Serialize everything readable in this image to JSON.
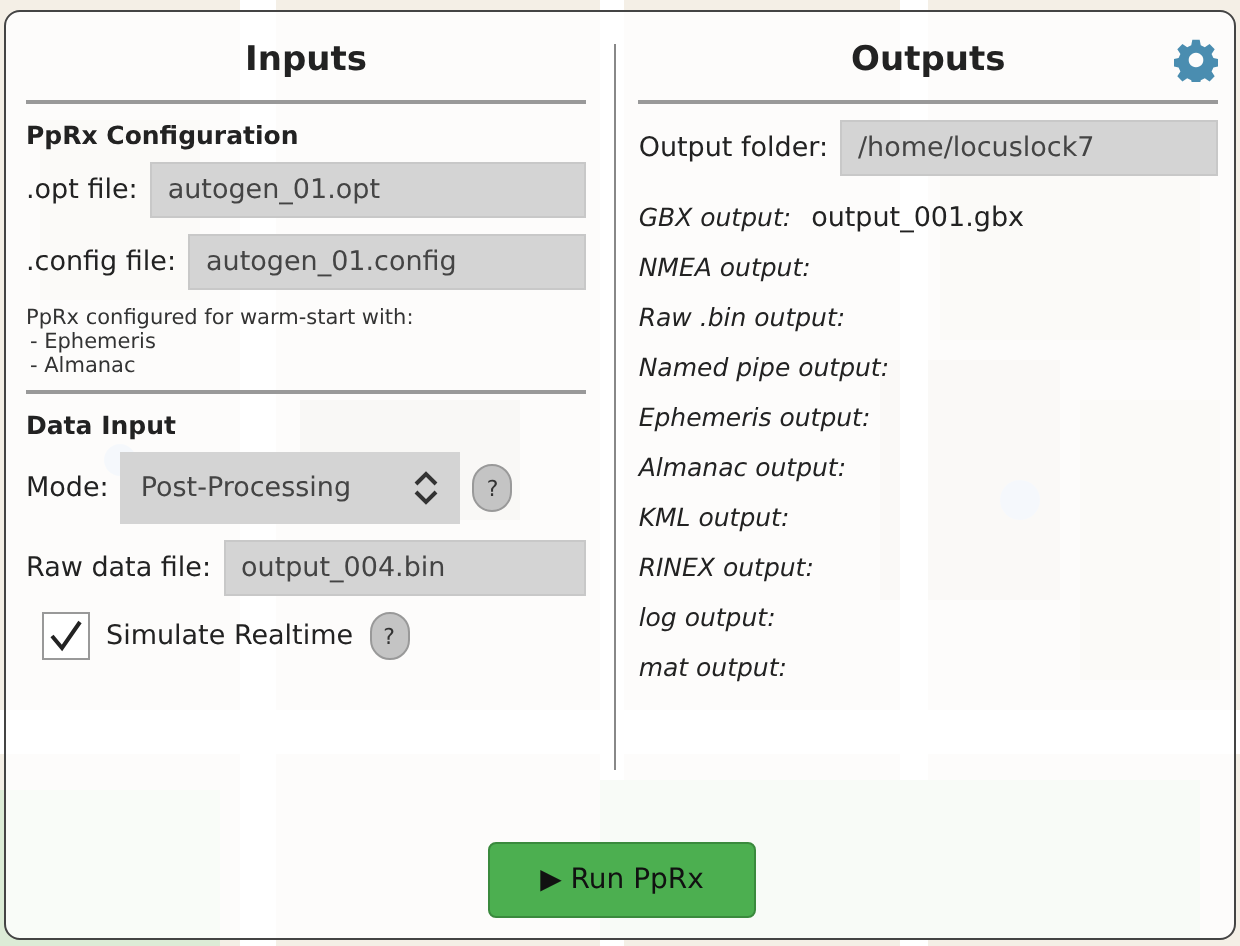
{
  "inputs": {
    "title": "Inputs",
    "config_heading": "PpRx Configuration",
    "opt_file": {
      "label": ".opt file:",
      "value": "autogen_01.opt"
    },
    "config_file": {
      "label": ".config file:",
      "value": "autogen_01.config"
    },
    "note": "PpRx configured for warm-start with:",
    "note_items": [
      "- Ephemeris",
      "- Almanac"
    ],
    "data_heading": "Data Input",
    "mode": {
      "label": "Mode:",
      "value": "Post-Processing",
      "help": "?"
    },
    "raw_file": {
      "label": "Raw data file:",
      "value": "output_004.bin"
    },
    "simulate": {
      "label": "Simulate Realtime",
      "checked": true,
      "help": "?"
    }
  },
  "outputs": {
    "title": "Outputs",
    "folder": {
      "label": "Output folder:",
      "value": "/home/locuslock7"
    },
    "items": [
      {
        "label": "GBX output:",
        "value": "output_001.gbx"
      },
      {
        "label": "NMEA output:"
      },
      {
        "label": "Raw .bin output:"
      },
      {
        "label": "Named pipe output:"
      },
      {
        "label": "Ephemeris output:"
      },
      {
        "label": "Almanac output:"
      },
      {
        "label": "KML output:"
      },
      {
        "label": "RINEX output:"
      },
      {
        "label": "log output:"
      },
      {
        "label": "mat output:"
      }
    ]
  },
  "run_button": "▶ Run PpRx"
}
